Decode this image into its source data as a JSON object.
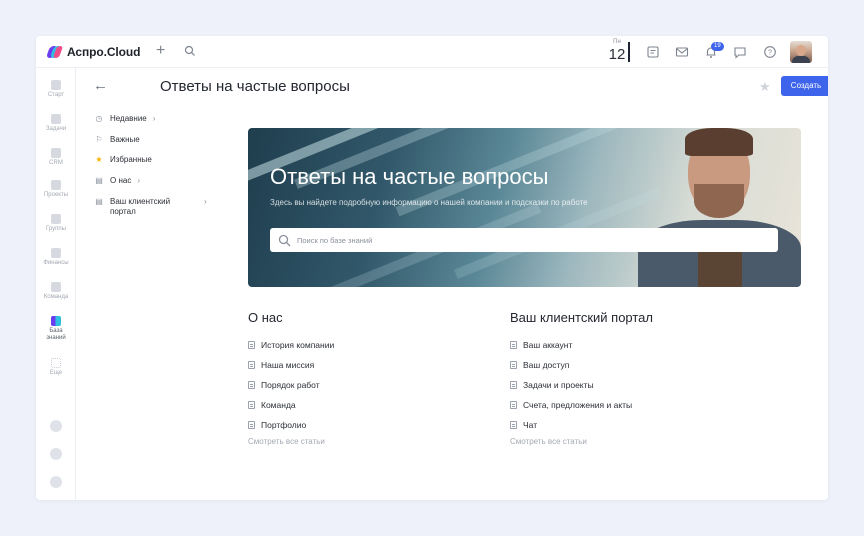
{
  "app": {
    "brand": "Аспро.Cloud",
    "accent_color": "#3e64ec"
  },
  "topbar": {
    "date_dow": "Пн",
    "date_day": "12",
    "notification_count": "19",
    "icons": [
      "plus-icon",
      "search-icon",
      "notes-icon",
      "mail-icon",
      "bell-icon",
      "chat-icon",
      "help-icon"
    ]
  },
  "rail": {
    "items": [
      {
        "label": "Старт",
        "icon": "home-icon"
      },
      {
        "label": "Задачи",
        "icon": "tasks-icon"
      },
      {
        "label": "CRM",
        "icon": "crm-icon"
      },
      {
        "label": "Проекты",
        "icon": "projects-icon"
      },
      {
        "label": "Группы",
        "icon": "groups-icon"
      },
      {
        "label": "Финансы",
        "icon": "finance-icon"
      },
      {
        "label": "Команда",
        "icon": "team-icon"
      },
      {
        "label": "База знаний",
        "icon": "knowledge-base-icon"
      },
      {
        "label": "Еще",
        "icon": "more-icon"
      }
    ]
  },
  "header": {
    "title": "Ответы на частые вопросы",
    "create_label": "Создать"
  },
  "tree": {
    "items": [
      {
        "label": "Недавние",
        "icon": "clock-icon",
        "has_chevron": true
      },
      {
        "label": "Важные",
        "icon": "flag-icon",
        "has_chevron": false
      },
      {
        "label": "Избранные",
        "icon": "star-icon",
        "has_chevron": false
      },
      {
        "label": "О нас",
        "icon": "document-icon",
        "has_chevron": true
      },
      {
        "label": "Ваш клиентский портал",
        "icon": "document-icon",
        "has_chevron": true
      }
    ]
  },
  "hero": {
    "title": "Ответы на частые вопросы",
    "subtitle": "Здесь вы найдете подробную информацию о нашей компании и подсказки по работе",
    "search_placeholder": "Поиск по базе знаний"
  },
  "sections": [
    {
      "title": "О нас",
      "articles": [
        "История компании",
        "Наша миссия",
        "Порядок работ",
        "Команда",
        "Портфолио"
      ],
      "see_all": "Смотреть все статьи"
    },
    {
      "title": "Ваш клиентский портал",
      "articles": [
        "Ваш аккаунт",
        "Ваш доступ",
        "Задачи и проекты",
        "Счета, предложения и акты",
        "Чат"
      ],
      "see_all": "Смотреть все статьи"
    }
  ]
}
